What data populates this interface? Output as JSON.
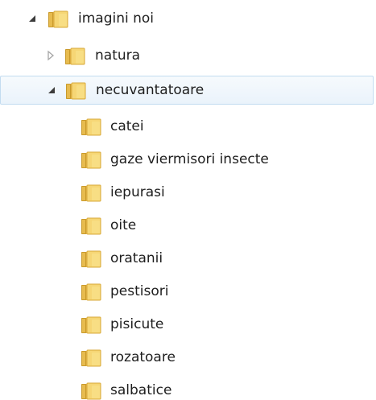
{
  "tree": {
    "root": {
      "label": "imagini noi",
      "expanded": true,
      "children": [
        {
          "label": "natura",
          "expanded": false
        },
        {
          "label": "necuvantatoare",
          "expanded": true,
          "selected": true,
          "children": [
            {
              "label": "catei"
            },
            {
              "label": "gaze viermisori insecte"
            },
            {
              "label": "iepurasi"
            },
            {
              "label": "oite"
            },
            {
              "label": "oratanii"
            },
            {
              "label": "pestisori"
            },
            {
              "label": "pisicute"
            },
            {
              "label": "rozatoare"
            },
            {
              "label": "salbatice"
            }
          ]
        }
      ]
    }
  },
  "colors": {
    "selection_border": "#c3dcf0",
    "selection_bg": "#eaf3fb",
    "folder_yellow": "#f1c85a",
    "folder_dark": "#d6a636",
    "arrow_expanded": "#3c3c3c",
    "arrow_collapsed": "#a6a6a6"
  },
  "icons": {
    "folder": "folder-icon",
    "expanded": "expanded-arrow-icon",
    "collapsed": "collapsed-arrow-icon"
  }
}
